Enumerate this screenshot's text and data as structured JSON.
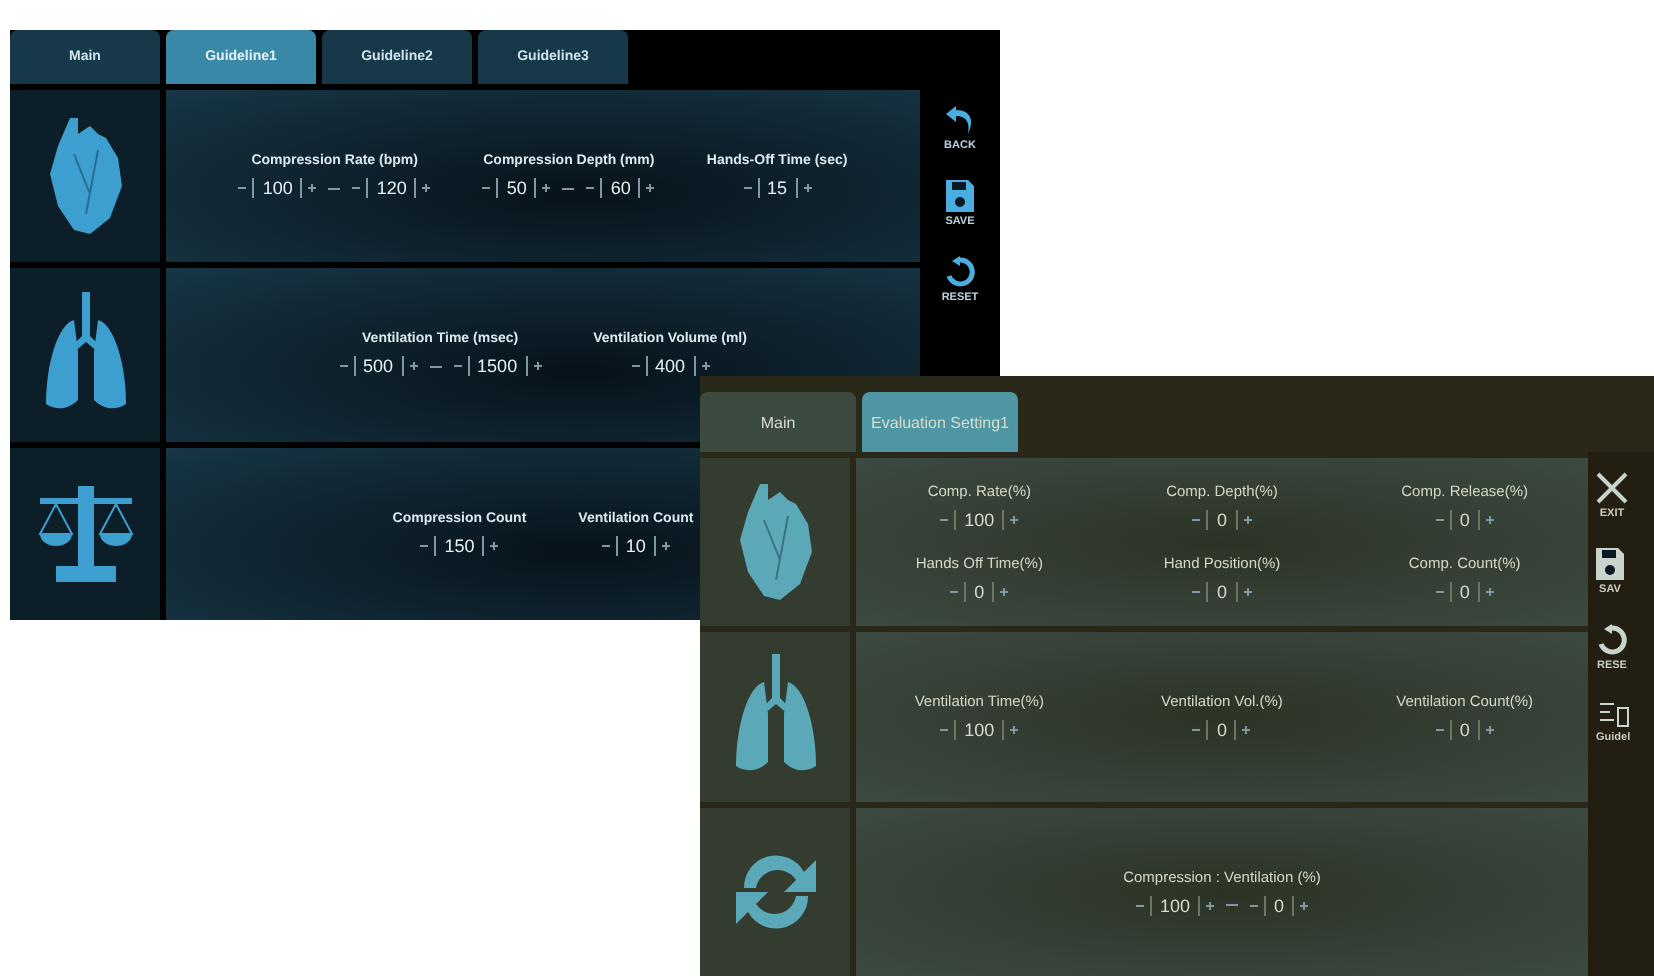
{
  "windows": [
    {
      "kind": "guideline",
      "tabs": [
        {
          "label": "Main",
          "selected": false
        },
        {
          "label": "Guideline1",
          "selected": true
        },
        {
          "label": "Guideline2",
          "selected": false
        },
        {
          "label": "Guideline3",
          "selected": false
        }
      ],
      "sections": [
        {
          "kind": "heart",
          "fields": [
            {
              "label": "Compression Rate (bpm)",
              "values": [
                "100",
                "120"
              ]
            },
            {
              "label": "Compression Depth (mm)",
              "values": [
                "50",
                "60"
              ]
            },
            {
              "label": "Hands-Off Time (sec)",
              "values": [
                "15"
              ]
            }
          ]
        },
        {
          "kind": "lungs",
          "fields": [
            {
              "label": "Ventilation Time (msec)",
              "values": [
                "500",
                "1500"
              ]
            },
            {
              "label": "Ventilation Volume (ml)",
              "values": [
                "400"
              ]
            }
          ]
        },
        {
          "kind": "scale",
          "fields": [
            {
              "label": "Compression Count",
              "values": [
                "150"
              ]
            },
            {
              "label": "Ventilation Count",
              "values": [
                "10"
              ]
            }
          ]
        }
      ],
      "side_buttons": [
        {
          "kind": "back",
          "label": "BACK"
        },
        {
          "kind": "save",
          "label": "SAVE"
        },
        {
          "kind": "reset",
          "label": "RESET"
        }
      ]
    },
    {
      "kind": "evaluation",
      "tabs": [
        {
          "label": "Main",
          "selected": false
        },
        {
          "label": "Evaluation Setting1",
          "selected": true
        }
      ],
      "sections": [
        {
          "kind": "heart",
          "fields": [
            {
              "label": "Comp. Rate(%)",
              "values": [
                "100"
              ]
            },
            {
              "label": "Comp. Depth(%)",
              "values": [
                "0"
              ]
            },
            {
              "label": "Comp. Release(%)",
              "values": [
                "0"
              ]
            },
            {
              "label": "Hands Off Time(%)",
              "values": [
                "0"
              ]
            },
            {
              "label": "Hand Position(%)",
              "values": [
                "0"
              ]
            },
            {
              "label": "Comp. Count(%)",
              "values": [
                "0"
              ]
            }
          ]
        },
        {
          "kind": "lungs",
          "fields": [
            {
              "label": "Ventilation Time(%)",
              "values": [
                "100"
              ]
            },
            {
              "label": "Ventilation Vol.(%)",
              "values": [
                "0"
              ]
            },
            {
              "label": "Ventilation Count(%)",
              "values": [
                "0"
              ]
            }
          ]
        },
        {
          "kind": "cycle",
          "fields": [
            {
              "label": "Compression : Ventilation (%)",
              "values": [
                "100",
                "0"
              ]
            }
          ]
        }
      ],
      "side_buttons": [
        {
          "kind": "exit",
          "label": "EXIT"
        },
        {
          "kind": "save",
          "label": "SAV"
        },
        {
          "kind": "reset",
          "label": "RESE"
        },
        {
          "kind": "guideline",
          "label": "Guidel"
        }
      ]
    }
  ]
}
